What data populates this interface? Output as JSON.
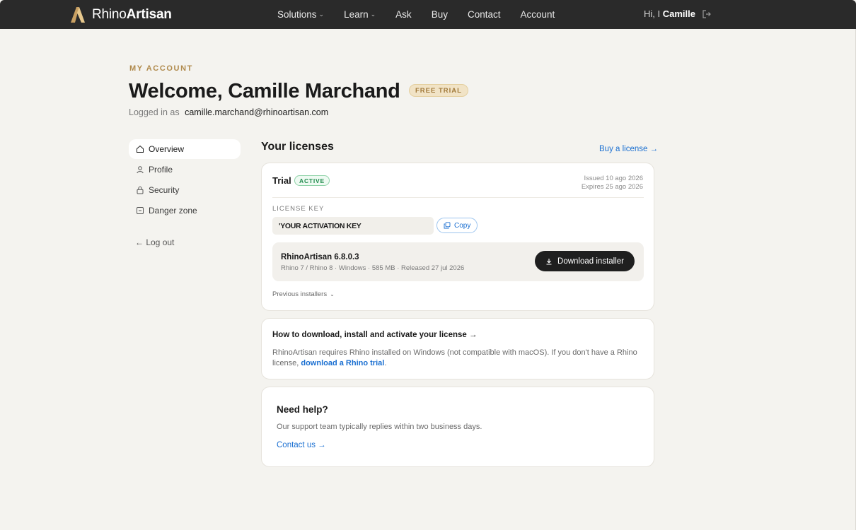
{
  "nav": {
    "brand_light": "Rhino",
    "brand_bold": "Artisan",
    "items": [
      {
        "label": "Solutions",
        "has_dropdown": true
      },
      {
        "label": "Learn",
        "has_dropdown": true
      },
      {
        "label": "Ask",
        "has_dropdown": false
      },
      {
        "label": "Buy",
        "has_dropdown": false
      },
      {
        "label": "Contact",
        "has_dropdown": false
      },
      {
        "label": "Account",
        "has_dropdown": false
      }
    ],
    "greeting_prefix": "Hi, I",
    "greeting_name": "Camille",
    "logout_icon": "logout-icon"
  },
  "header": {
    "eyebrow": "MY ACCOUNT",
    "title": "Welcome,  Camille Marchand",
    "plan_badge": "FREE TRIAL",
    "logged_in_label": "Logged in as",
    "email": "camille.marchand@rhinoartisan.com"
  },
  "sidebar": {
    "items": [
      {
        "label": "Overview",
        "icon": "home-icon",
        "active": true
      },
      {
        "label": "Profile",
        "icon": "user-icon",
        "active": false
      },
      {
        "label": "Security",
        "icon": "lock-icon",
        "active": false
      },
      {
        "label": "Danger zone",
        "icon": "danger-icon",
        "active": false
      }
    ],
    "logout": "← Log out"
  },
  "licenses": {
    "heading": "Your licenses",
    "buy_link": "Buy a license →",
    "card": {
      "type": "Trial",
      "status": "ACTIVE",
      "issued": "Issued 10 ago 2026",
      "expires": "Expires 25 ago 2026",
      "key_label": "LICENSE KEY",
      "key_value": "'YOUR ACTIVATION KEY",
      "copy_label": "Copy",
      "installer": {
        "name": "RhinoArtisan 6.8.0.3",
        "meta": "Rhino 7 / Rhino 8 · Windows · 585 MB · Released 27 jul 2026",
        "download_label": "Download installer"
      },
      "previous_installers": "Previous installers"
    }
  },
  "howto": {
    "link": "How to download, install and activate your license →",
    "text": "RhinoArtisan requires Rhino installed on Windows (not compatible with macOS). If you don't have a Rhino license,",
    "trial_link": "download a Rhino trial",
    "trail": "."
  },
  "help": {
    "title": "Need help?",
    "text": "Our support team typically replies within two business days.",
    "link": "Contact us →"
  },
  "colors": {
    "accent_gold": "#b08a4c",
    "link_blue": "#1a6fd1",
    "active_green": "#1f8a4c",
    "topbar": "#2a2a2a",
    "background": "#f4f3ef"
  }
}
